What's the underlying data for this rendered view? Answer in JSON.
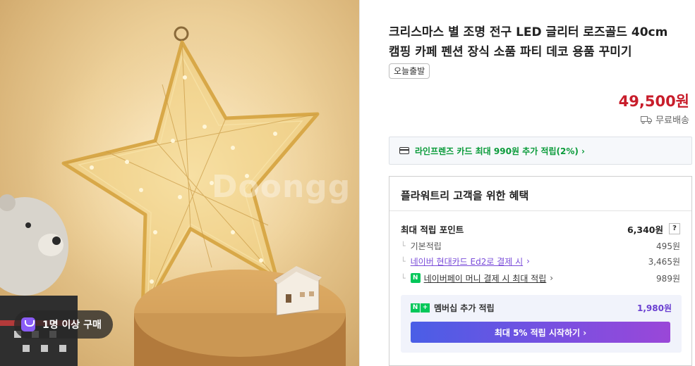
{
  "image": {
    "watermark": "Doongg",
    "buyers_badge": "1명 이상 구매"
  },
  "product": {
    "title_line1": "크리스마스 별 조명 전구 LED 글리터 로즈골드 40cm",
    "title_line2": "캠핑 카페 펜션 장식 소품 파티 데코 용품 꾸미기",
    "tag": "오늘출발",
    "price": "49,500원",
    "delivery": "무료배송"
  },
  "card_banner": {
    "text": "라인프렌즈 카드 최대 990원 추가 적립(2%) ›"
  },
  "benefits": {
    "title": "플라워트리 고객을 위한 혜택",
    "max_points_label": "최대 적립 포인트",
    "max_points_value": "6,340원",
    "help": "?",
    "basic_label": "기본적립",
    "basic_value": "495원",
    "card_label": "네이버 현대카드 Ed2로 결제 시",
    "card_value": "3,465원",
    "pay_label": "네이버페이 머니 결제 시 최대 적립",
    "pay_value": "989원",
    "membership_label": "멤버십 추가 적립",
    "membership_value": "1,980원",
    "cta": "최대 5% 적립 시작하기 ›"
  },
  "colors": {
    "price": "#c81d2b",
    "card_banner_text": "#0a9b3a",
    "accent_purple": "#7a4cd9",
    "naver_green": "#03c75a"
  }
}
